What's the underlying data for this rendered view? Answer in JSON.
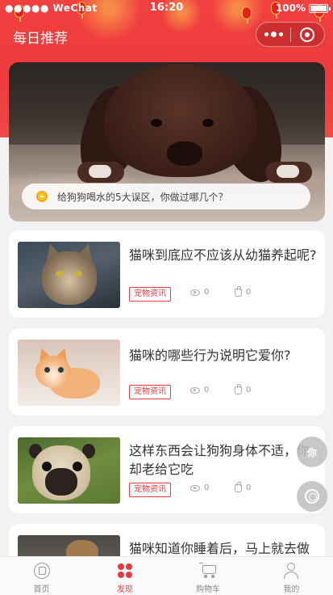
{
  "status_bar": {
    "carrier": "●●●●● WeChat",
    "time": "16:20",
    "battery": "100%"
  },
  "nav": {
    "title": "每日推荐"
  },
  "banner": {
    "caption": "给狗狗喝水的5大误区，你做过哪几个？"
  },
  "articles": [
    {
      "title": "猫咪到底应不应该从幼猫养起呢?",
      "tag": "宠物资讯",
      "views": "0",
      "likes": "0"
    },
    {
      "title": "猫咪的哪些行为说明它爱你?",
      "tag": "宠物资讯",
      "views": "0",
      "likes": "0"
    },
    {
      "title": "这样东西会让狗狗身体不适，你却老给它吃",
      "tag": "宠物资讯",
      "views": "0",
      "likes": "0"
    },
    {
      "title": "猫咪知道你睡着后，马上就去做"
    }
  ],
  "float": {
    "ni_label": "你"
  },
  "tabbar": {
    "items": [
      {
        "label": "首页",
        "icon": "home-icon"
      },
      {
        "label": "发现",
        "icon": "discover-icon"
      },
      {
        "label": "购物车",
        "icon": "cart-icon"
      },
      {
        "label": "我的",
        "icon": "user-icon"
      }
    ],
    "active": "发现"
  },
  "colors": {
    "accent": "#e83a3f",
    "header_red": "#ee3b3d"
  }
}
